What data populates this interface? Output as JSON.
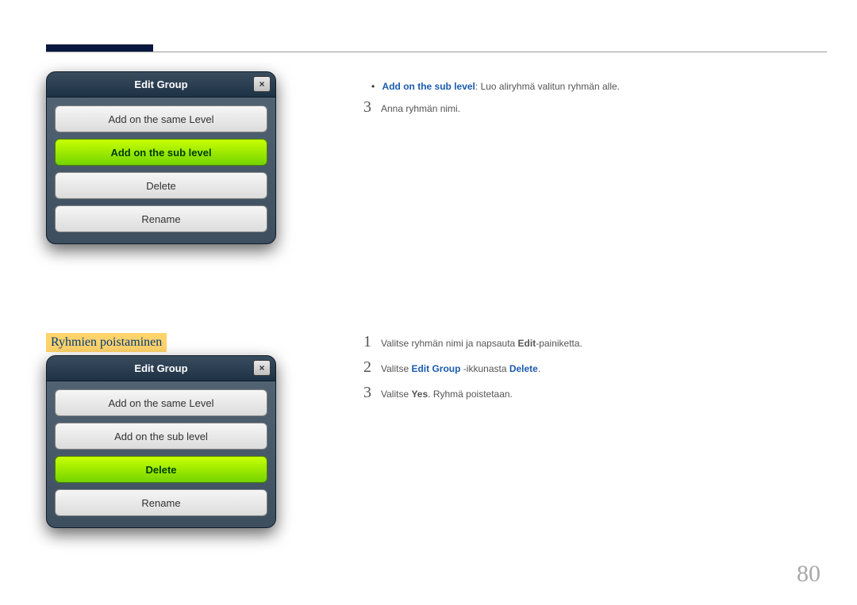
{
  "page_number": "80",
  "section_heading": "Ryhmien poistaminen",
  "dialog1": {
    "title": "Edit Group",
    "close": "×",
    "btn1": "Add on the same Level",
    "btn2": "Add on the sub level",
    "btn3": "Delete",
    "btn4": "Rename"
  },
  "dialog2": {
    "title": "Edit Group",
    "close": "×",
    "btn1": "Add on the same Level",
    "btn2": "Add on the sub level",
    "btn3": "Delete",
    "btn4": "Rename"
  },
  "top_bullet": {
    "label": "Add on the sub level",
    "rest": ": Luo aliryhmä valitun ryhmän alle."
  },
  "step_top_3": {
    "num": "3",
    "text": "Anna ryhmän nimi."
  },
  "steps": {
    "s1": {
      "num": "1",
      "pre": "Valitse ryhmän nimi ja napsauta ",
      "bold": "Edit",
      "post": "-painiketta."
    },
    "s2": {
      "num": "2",
      "pre": "Valitse ",
      "link1": "Edit Group",
      "mid": " -ikkunasta ",
      "link2": "Delete",
      "post": "."
    },
    "s3": {
      "num": "3",
      "pre": "Valitse ",
      "bold": "Yes",
      "post": ". Ryhmä poistetaan."
    }
  }
}
